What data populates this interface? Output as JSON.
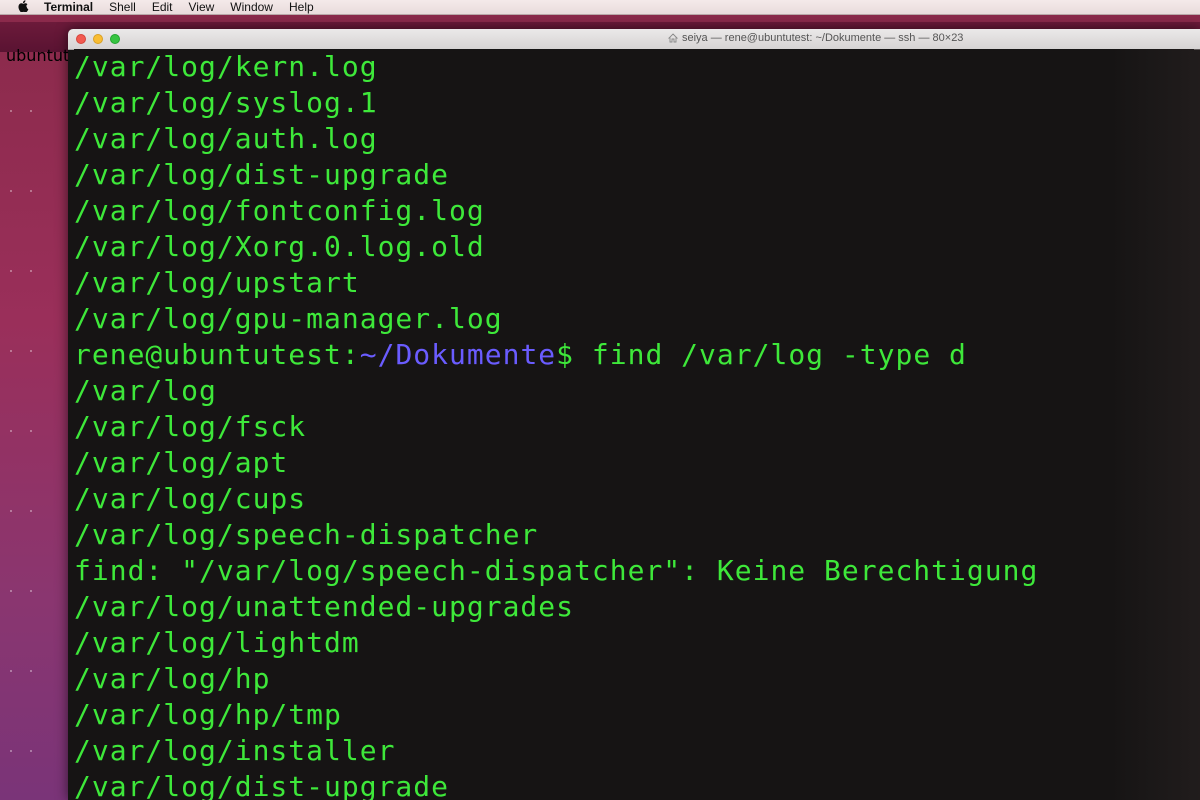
{
  "menubar": {
    "apple_icon": "apple-icon",
    "items": [
      "Terminal",
      "Shell",
      "Edit",
      "View",
      "Window",
      "Help"
    ]
  },
  "background_window": {
    "label": "ubuntut"
  },
  "window": {
    "title": "seiya — rene@ubuntutest: ~/Dokumente — ssh — 80×23",
    "title_icon": "home-icon"
  },
  "terminal": {
    "lines_before": [
      "/var/log/kern.log",
      "/var/log/syslog.1",
      "/var/log/auth.log",
      "/var/log/dist-upgrade",
      "/var/log/fontconfig.log",
      "/var/log/Xorg.0.log.old",
      "/var/log/upstart",
      "/var/log/gpu-manager.log"
    ],
    "prompt": {
      "user_host": "rene@ubuntutest",
      "separator": ":",
      "path": "~/Dokumente",
      "symbol": "$",
      "command": " find /var/log -type d"
    },
    "lines_after": [
      "/var/log",
      "/var/log/fsck",
      "/var/log/apt",
      "/var/log/cups",
      "/var/log/speech-dispatcher",
      "find: \"/var/log/speech-dispatcher\": Keine Berechtigung",
      "/var/log/unattended-upgrades",
      "/var/log/lightdm",
      "/var/log/hp",
      "/var/log/hp/tmp",
      "/var/log/installer",
      "/var/log/dist-upgrade"
    ]
  },
  "colors": {
    "text_green": "#3ee83a",
    "path_blue": "#6a5cff",
    "terminal_bg": "#161414"
  }
}
